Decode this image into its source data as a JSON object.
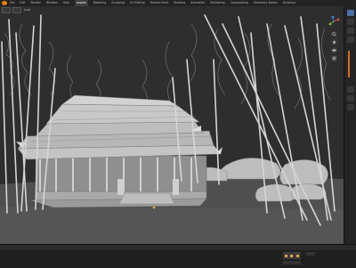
{
  "app": {
    "menu": [
      "File",
      "Edit",
      "Render",
      "Window",
      "Help",
      "Layout",
      "Modeling",
      "Sculpting",
      "UV Editing",
      "Texture Paint",
      "Shading",
      "Animation",
      "Rendering",
      "Compositing",
      "Geometry Nodes",
      "Scripting"
    ],
    "active_menu_index": 0
  },
  "viewport": {
    "shading": "Solid",
    "navigation": [
      "zoom-icon",
      "hand-icon",
      "camera-icon",
      "grid-icon"
    ]
  },
  "colors": {
    "sky": "#2e2e2e",
    "ground": "#4f4f4f",
    "tree": "#d5d5d5",
    "building": "#b6b6b6",
    "accent": "#e87d0d"
  }
}
